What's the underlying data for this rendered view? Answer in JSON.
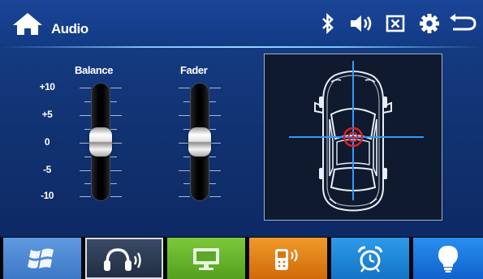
{
  "header": {
    "title": "Audio",
    "icons": [
      "home-icon",
      "bluetooth-icon",
      "speaker-icon",
      "close-box-icon",
      "gear-icon",
      "back-icon"
    ]
  },
  "sliders": {
    "tick_labels": [
      "+10",
      "+5",
      "0",
      "-5",
      "-10"
    ],
    "balance": {
      "label": "Balance",
      "value": 0
    },
    "fader": {
      "label": "Fader",
      "value": 0
    }
  },
  "car_panel": {
    "icons": [
      "car-top-view-icon",
      "sound-focus-target-icon"
    ]
  },
  "bottom_nav": [
    {
      "name": "windows-icon",
      "color": "#4a86cf",
      "active": false
    },
    {
      "name": "headphones-audio-icon",
      "color": "#2c3b56",
      "active": true
    },
    {
      "name": "monitor-icon",
      "color": "#64b22a",
      "active": false
    },
    {
      "name": "phone-call-icon",
      "color": "#e07b12",
      "active": false
    },
    {
      "name": "alarm-clock-icon",
      "color": "#1c88d8",
      "active": false
    },
    {
      "name": "lightbulb-icon",
      "color": "#1c74e0",
      "active": false
    }
  ],
  "colors": {
    "background": "#173f88",
    "crosshair": "#2f9bff",
    "target": "#e0202a",
    "car_outline": "#e8eef8"
  }
}
